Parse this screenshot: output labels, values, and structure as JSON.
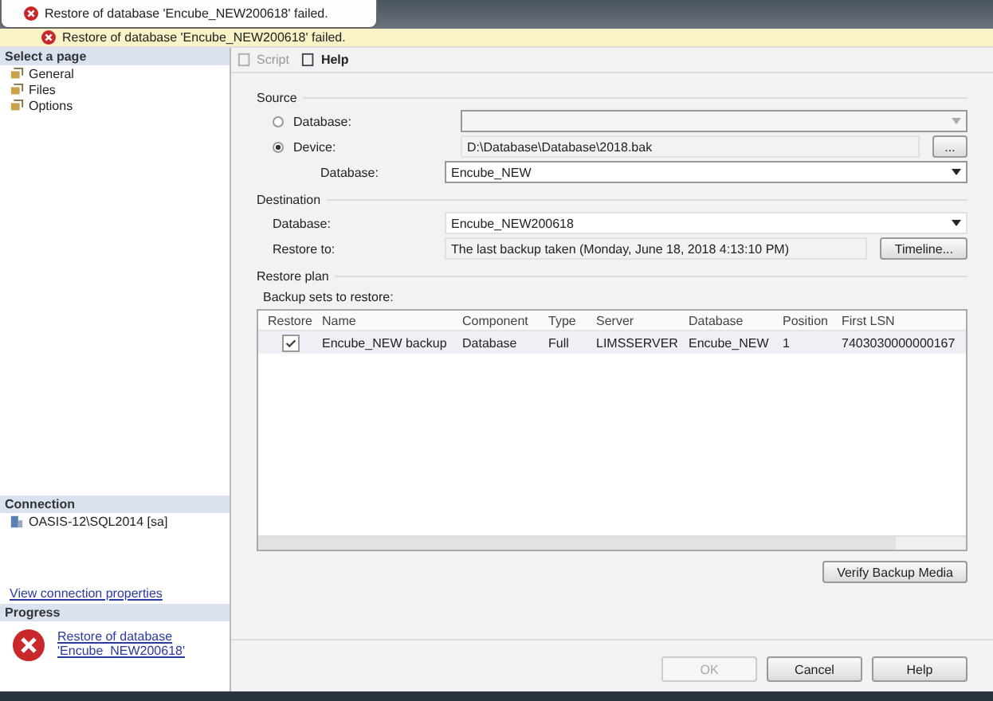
{
  "tooltip": {
    "message": "Restore of database 'Encube_NEW200618' failed."
  },
  "error_bar": {
    "message": "Restore of database 'Encube_NEW200618' failed."
  },
  "sidebar": {
    "title": "Select a page",
    "items": [
      {
        "label": "General"
      },
      {
        "label": "Files"
      },
      {
        "label": "Options"
      }
    ]
  },
  "connection": {
    "title": "Connection",
    "server": "OASIS-12\\SQL2014 [sa]",
    "link": "View connection properties"
  },
  "progress": {
    "title": "Progress",
    "message": "Restore of database 'Encube_NEW200618'"
  },
  "toolbar": {
    "items": [
      {
        "label": "Script",
        "disabled": true
      },
      {
        "label": "Help",
        "disabled": false
      }
    ]
  },
  "source": {
    "title": "Source",
    "options": [
      {
        "label": "Database:",
        "selected": false
      },
      {
        "label": "Device:",
        "selected": true,
        "value": "D:\\Database\\Database\\2018.bak"
      }
    ],
    "browse_button": "...",
    "database": {
      "label": "Database:",
      "value": "Encube_NEW"
    }
  },
  "destination": {
    "title": "Destination",
    "database": {
      "label": "Database:",
      "value": "Encube_NEW200618"
    },
    "restore_to": {
      "label": "Restore to:",
      "value": "The last backup taken (Monday, June 18, 2018 4:13:10 PM)"
    },
    "timeline_button": "Timeline..."
  },
  "restore_plan": {
    "title": "Restore plan",
    "subtitle": "Backup sets to restore:",
    "checkbox_column": "Restore",
    "columns": [
      "Name",
      "Component",
      "Type",
      "Server",
      "Database",
      "Position",
      "First LSN"
    ],
    "rows": [
      {
        "checked": true,
        "cells": [
          "Encube_NEW backup",
          "Database",
          "Full",
          "LIMSSERVER",
          "Encube_NEW",
          "1",
          "7403030000000167"
        ]
      }
    ],
    "verify_button": "Verify Backup Media"
  },
  "buttons": [
    {
      "label": "OK",
      "disabled": true
    },
    {
      "label": "Cancel",
      "disabled": false
    },
    {
      "label": "Help",
      "disabled": false
    }
  ]
}
